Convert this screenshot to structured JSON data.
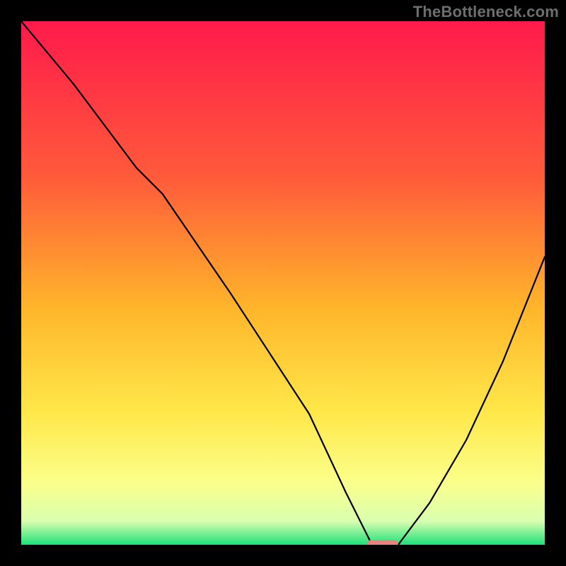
{
  "watermark": "TheBottleneck.com",
  "chart_data": {
    "type": "line",
    "title": "",
    "xlabel": "",
    "ylabel": "",
    "xlim": [
      0,
      100
    ],
    "ylim": [
      0,
      100
    ],
    "grid": false,
    "legend": false,
    "background_gradient": {
      "stops": [
        {
          "offset": 0.0,
          "color": "#ff1a4b"
        },
        {
          "offset": 0.3,
          "color": "#ff5b3a"
        },
        {
          "offset": 0.55,
          "color": "#ffb62a"
        },
        {
          "offset": 0.75,
          "color": "#ffe84a"
        },
        {
          "offset": 0.88,
          "color": "#fbff8a"
        },
        {
          "offset": 0.955,
          "color": "#d9ffb0"
        },
        {
          "offset": 1.0,
          "color": "#1ee07a"
        }
      ]
    },
    "series": [
      {
        "name": "bottleneck-curve",
        "color": "#000000",
        "width": 2.2,
        "x": [
          0,
          10,
          22,
          27,
          40,
          55,
          62,
          67,
          72,
          78,
          85,
          92,
          100
        ],
        "y": [
          100,
          88,
          72,
          67,
          48,
          25,
          10,
          0,
          0,
          8,
          20,
          35,
          55
        ]
      }
    ],
    "marker": {
      "name": "optimal-marker",
      "x": 69,
      "y": 0,
      "width_pct": 6,
      "height_pct": 1.8,
      "color": "#e9817f"
    }
  }
}
